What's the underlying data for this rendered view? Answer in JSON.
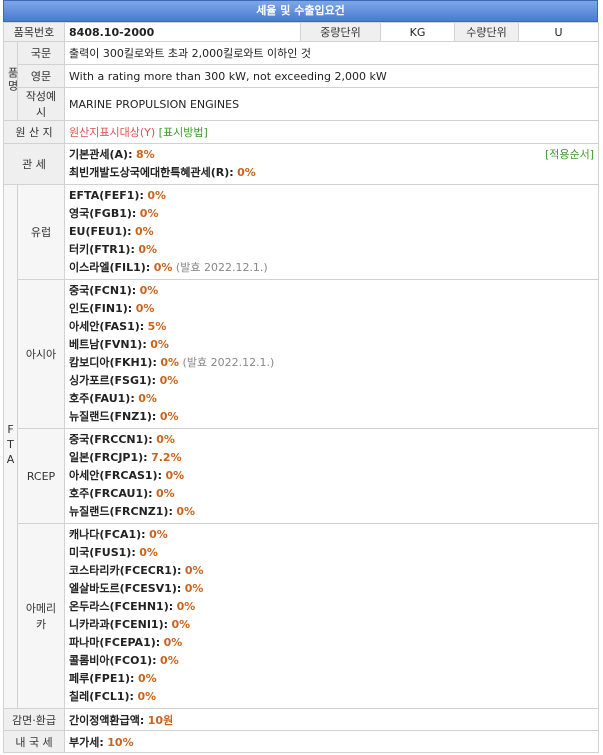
{
  "title": "세율 및 수출입요건",
  "hs": {
    "label": "품목번호",
    "value": "8408.10-2000",
    "weight_label": "중량단위",
    "weight_value": "KG",
    "qty_label": "수량단위",
    "qty_value": "U"
  },
  "name_group_label": "품명",
  "names": [
    {
      "label": "국문",
      "value": "출력이 300킬로와트 초과 2,000킬로와트 이하인 것"
    },
    {
      "label": "영문",
      "value": "With a rating more than 300 kW, not exceeding 2,000 kW"
    },
    {
      "label": "작성예시",
      "value": "MARINE PROPULSION ENGINES"
    }
  ],
  "origin": {
    "label": "원 산 지",
    "status": "원산지표시대상(Y)",
    "method": "[표시방법]"
  },
  "tariff": {
    "label": "관 세",
    "basic_label": "기본관세(A):",
    "basic_value": "8%",
    "ldc_label": "최빈개발도상국에대한특혜관세(R):",
    "ldc_value": "0%",
    "order_link": "[적용순서]"
  },
  "fta_label": "FTA",
  "fta_groups": [
    {
      "region": "유럽",
      "items": [
        {
          "name": "EFTA(FEF1):",
          "rate": "0%",
          "note": ""
        },
        {
          "name": "영국(FGB1):",
          "rate": "0%",
          "note": ""
        },
        {
          "name": "EU(FEU1):",
          "rate": "0%",
          "note": ""
        },
        {
          "name": "터키(FTR1):",
          "rate": "0%",
          "note": ""
        },
        {
          "name": "이스라엘(FIL1):",
          "rate": "0%",
          "note": "(발효 2022.12.1.)"
        }
      ]
    },
    {
      "region": "아시아",
      "items": [
        {
          "name": "중국(FCN1):",
          "rate": "0%",
          "note": ""
        },
        {
          "name": "인도(FIN1):",
          "rate": "0%",
          "note": ""
        },
        {
          "name": "아세안(FAS1):",
          "rate": "5%",
          "note": ""
        },
        {
          "name": "베트남(FVN1):",
          "rate": "0%",
          "note": ""
        },
        {
          "name": "캄보디아(FKH1):",
          "rate": "0%",
          "note": "(발효 2022.12.1.)"
        },
        {
          "name": "싱가포르(FSG1):",
          "rate": "0%",
          "note": ""
        },
        {
          "name": "호주(FAU1):",
          "rate": "0%",
          "note": ""
        },
        {
          "name": "뉴질랜드(FNZ1):",
          "rate": "0%",
          "note": ""
        }
      ]
    },
    {
      "region": "RCEP",
      "items": [
        {
          "name": "중국(FRCCN1):",
          "rate": "0%",
          "note": ""
        },
        {
          "name": "일본(FRCJP1):",
          "rate": "7.2%",
          "note": ""
        },
        {
          "name": "아세안(FRCAS1):",
          "rate": "0%",
          "note": ""
        },
        {
          "name": "호주(FRCAU1):",
          "rate": "0%",
          "note": ""
        },
        {
          "name": "뉴질랜드(FRCNZ1):",
          "rate": "0%",
          "note": ""
        }
      ]
    },
    {
      "region": "아메리카",
      "items": [
        {
          "name": "캐나다(FCA1):",
          "rate": "0%",
          "note": ""
        },
        {
          "name": "미국(FUS1):",
          "rate": "0%",
          "note": ""
        },
        {
          "name": "코스타리카(FCECR1):",
          "rate": "0%",
          "note": ""
        },
        {
          "name": "엘살바도르(FCESV1):",
          "rate": "0%",
          "note": ""
        },
        {
          "name": "온두라스(FCEHN1):",
          "rate": "0%",
          "note": ""
        },
        {
          "name": "니카라과(FCENI1):",
          "rate": "0%",
          "note": ""
        },
        {
          "name": "파나마(FCEPA1):",
          "rate": "0%",
          "note": ""
        },
        {
          "name": "콜롬비아(FCO1):",
          "rate": "0%",
          "note": ""
        },
        {
          "name": "페루(FPE1):",
          "rate": "0%",
          "note": ""
        },
        {
          "name": "칠레(FCL1):",
          "rate": "0%",
          "note": ""
        }
      ]
    }
  ],
  "refund": {
    "label": "감면·환급",
    "text": "간이정액환급액:",
    "value": "10원"
  },
  "domestic": {
    "label": "내 국 세",
    "text": "부가세:",
    "value": "10%"
  },
  "colors": {
    "title_bg": "#4a7ad0",
    "rate": "#c8641e",
    "link_green": "#3f9a2c",
    "origin_red": "#d9534f"
  }
}
